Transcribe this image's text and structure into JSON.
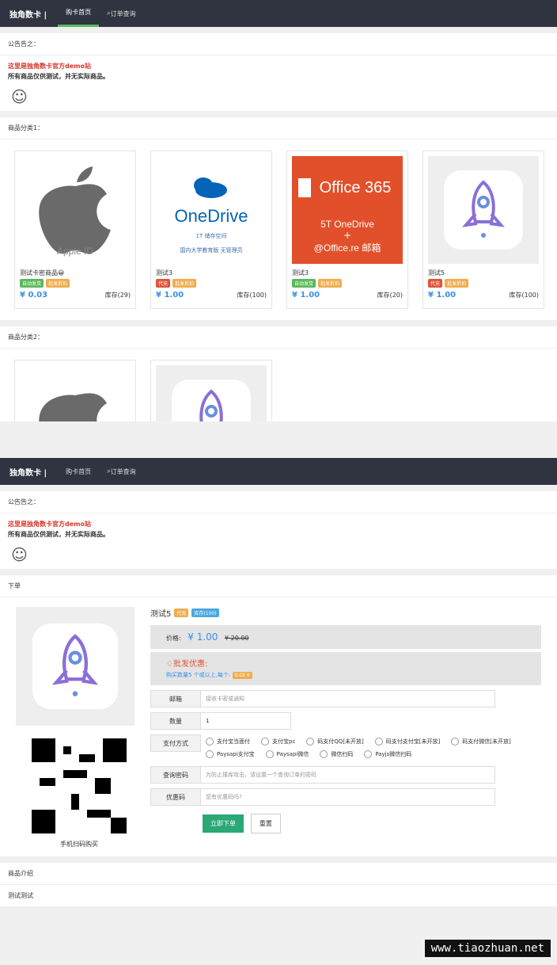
{
  "top": {
    "brand": "独角数卡 |",
    "nav": [
      "购卡首页",
      "订单查询"
    ],
    "notice": {
      "title": "公告告之：",
      "red": "这里是独角数卡官方demo站",
      "black": "所有商品仅供测试，并无实际商品。"
    },
    "category1": {
      "title": "商品分类1：",
      "cards": [
        {
          "name": "测试卡密商品😀",
          "badges": [
            {
              "text": "自动发货",
              "class": "b-green"
            },
            {
              "text": "批发折扣",
              "class": "b-orange"
            }
          ],
          "price": "¥ 0.03",
          "stock": "库存(29)",
          "img": "Apple ID"
        },
        {
          "name": "测试3",
          "badges": [
            {
              "text": "代充",
              "class": "b-red"
            },
            {
              "text": "批发折扣",
              "class": "b-orange"
            }
          ],
          "price": "¥ 1.00",
          "stock": "库存(100)",
          "img": "OneDrive"
        },
        {
          "name": "测试3",
          "badges": [
            {
              "text": "自动发货",
              "class": "b-green"
            },
            {
              "text": "批发折扣",
              "class": "b-orange"
            }
          ],
          "price": "¥ 1.00",
          "stock": "库存(20)",
          "img": "Office 365"
        },
        {
          "name": "测试5",
          "badges": [
            {
              "text": "代充",
              "class": "b-red"
            },
            {
              "text": "批发折扣",
              "class": "b-orange"
            }
          ],
          "price": "¥ 1.00",
          "stock": "库存(100)",
          "img": "rocket"
        }
      ]
    },
    "category2": {
      "title": "商品分类2："
    }
  },
  "bottom": {
    "brand": "独角数卡 |",
    "nav": [
      "购卡首页",
      "订单查询"
    ],
    "notice": {
      "title": "公告告之：",
      "red": "这里是独角数卡官方demo站",
      "black": "所有商品仅供测试，并无实际商品。"
    },
    "order_title": "下单",
    "product": {
      "name": "测试5",
      "tag": "代充",
      "stock": "库存(100)",
      "price_label": "价格:",
      "price": "¥ 1.00",
      "old_price": "¥ 20.00"
    },
    "discount": {
      "title": "批发优惠:",
      "text": "购买数量5 个或以上,每个:",
      "value": "0.02 ¥"
    },
    "fields": {
      "email_label": "邮箱",
      "email_ph": "接收卡密或通知",
      "qty_label": "数量",
      "qty_value": "1",
      "pay_label": "支付方式",
      "pay_options": [
        "支付宝当面付",
        "支付宝pc",
        "码支付QQ[未开放]",
        "码支付支付宝[未开放]",
        "码支付微信[未开放]",
        "Paysapi支付宝",
        "Paysapi微信",
        "微信扫码",
        "Payjs微信扫码"
      ],
      "pwd_label": "查询密码",
      "pwd_ph": "为防止撞库攻击，请设置一个查询订单的密码",
      "coupon_label": "优惠码",
      "coupon_ph": "您有优惠码吗?"
    },
    "buttons": {
      "submit": "立即下单",
      "reset": "重置"
    },
    "qr_caption": "手机扫码购买",
    "intro_title": "商品介绍",
    "intro_text": "测试测试"
  },
  "watermark": "www.tiaozhuan.net"
}
